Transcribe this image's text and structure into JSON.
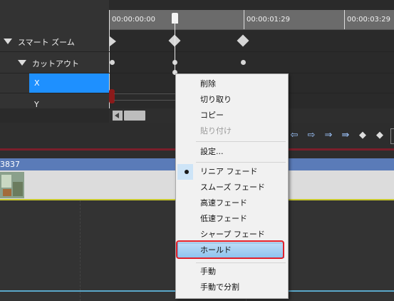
{
  "ruler": {
    "timecodes": [
      "00:00:00:00",
      "00:00:01:29",
      "00:00:03:29"
    ]
  },
  "tracks": {
    "smart_zoom": "スマート ズーム",
    "cutout": "カットアウト",
    "x": "X",
    "y": "Y"
  },
  "clip": {
    "label": "3837"
  },
  "toolbar": {
    "icons": [
      "prev-keyframe-icon",
      "next-keyframe-icon",
      "goto-keyframe-icon",
      "add-keyframe-icon",
      "delete-keyframe-icon"
    ]
  },
  "context_menu": {
    "delete": "削除",
    "cut": "切り取り",
    "copy": "コピー",
    "paste": "貼り付け",
    "settings": "設定...",
    "linear_fade": "リニア フェード",
    "smooth_fade": "スムーズ フェード",
    "fast_fade": "高速フェード",
    "slow_fade": "低速フェード",
    "sharp_fade": "シャープ フェード",
    "hold": "ホールド",
    "manual": "手動",
    "manual_split": "手動で分割"
  },
  "colors": {
    "selected_row": "#1e90ff",
    "menu_highlight": "#8fc4ee",
    "red_outline": "#e0202a"
  }
}
